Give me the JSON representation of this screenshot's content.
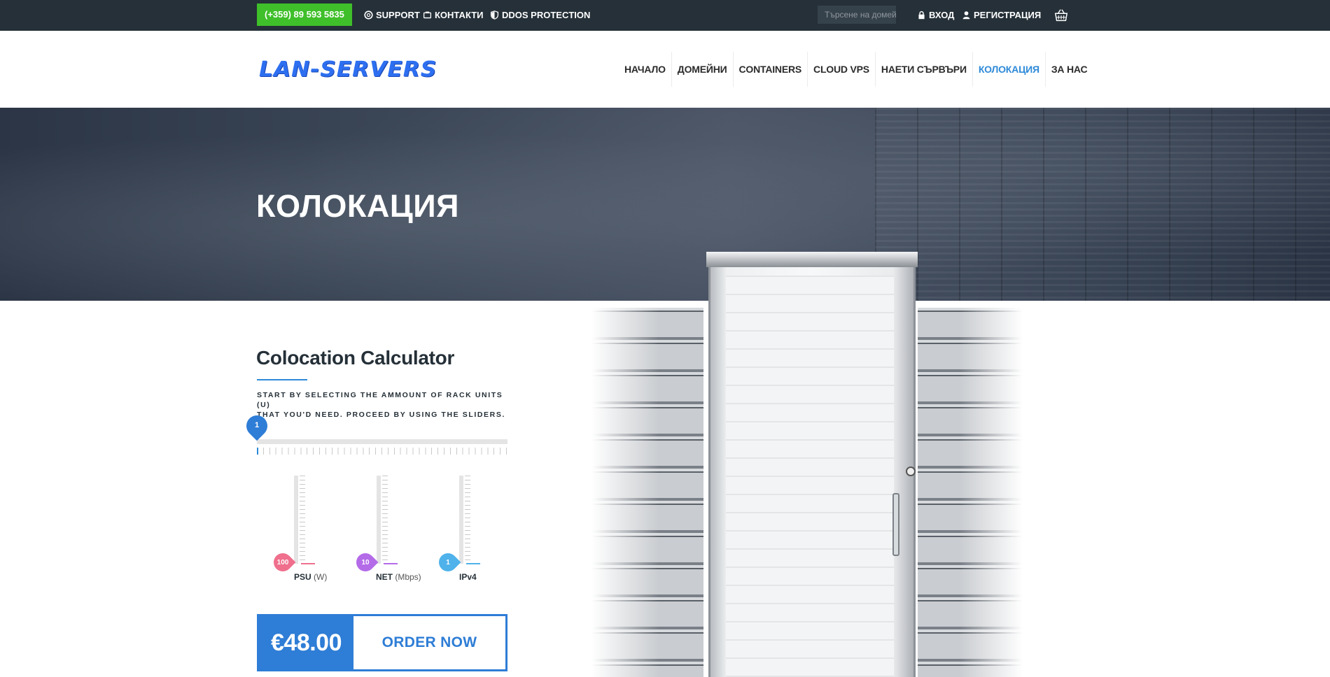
{
  "topbar": {
    "phone": "(+359) 89 593 5835",
    "support": "SUPPORT",
    "contacts": "КОНТАКТИ",
    "ddos": "DDOS PROTECTION",
    "search_placeholder": "Търсене на домейн",
    "login": "ВХОД",
    "register": "РЕГИСТРАЦИЯ"
  },
  "header": {
    "logo": "LAN-SERVERS",
    "nav": [
      "НАЧАЛО",
      "ДОМЕЙНИ",
      "CONTAINERS",
      "CLOUD VPS",
      "НАЕТИ СЪРВЪРИ",
      "КОЛОКАЦИЯ",
      "ЗА НАС"
    ],
    "active_nav": "КОЛОКАЦИЯ"
  },
  "hero": {
    "title": "КОЛОКАЦИЯ"
  },
  "calculator": {
    "title": "Colocation Calculator",
    "description_line1": "START BY SELECTING THE AMMOUNT OF RACK UNITS (U)",
    "description_line2": "THAT YOU'D NEED. PROCEED BY USING THE SLIDERS.",
    "rack_units": "1",
    "sliders": [
      {
        "name": "PSU",
        "unit": "(W)",
        "value": "100",
        "color": "#ef6f8c"
      },
      {
        "name": "NET",
        "unit": "(Mbps)",
        "value": "10",
        "color": "#b46be8"
      },
      {
        "name": "IPv4",
        "unit": "",
        "value": "1",
        "color": "#4fb2ea"
      }
    ],
    "price": "€48.00",
    "order_label": "ORDER NOW"
  },
  "colors": {
    "accent": "#2e7dd6",
    "phone_bg": "#3fbf2a",
    "topbar_bg": "#253038"
  }
}
